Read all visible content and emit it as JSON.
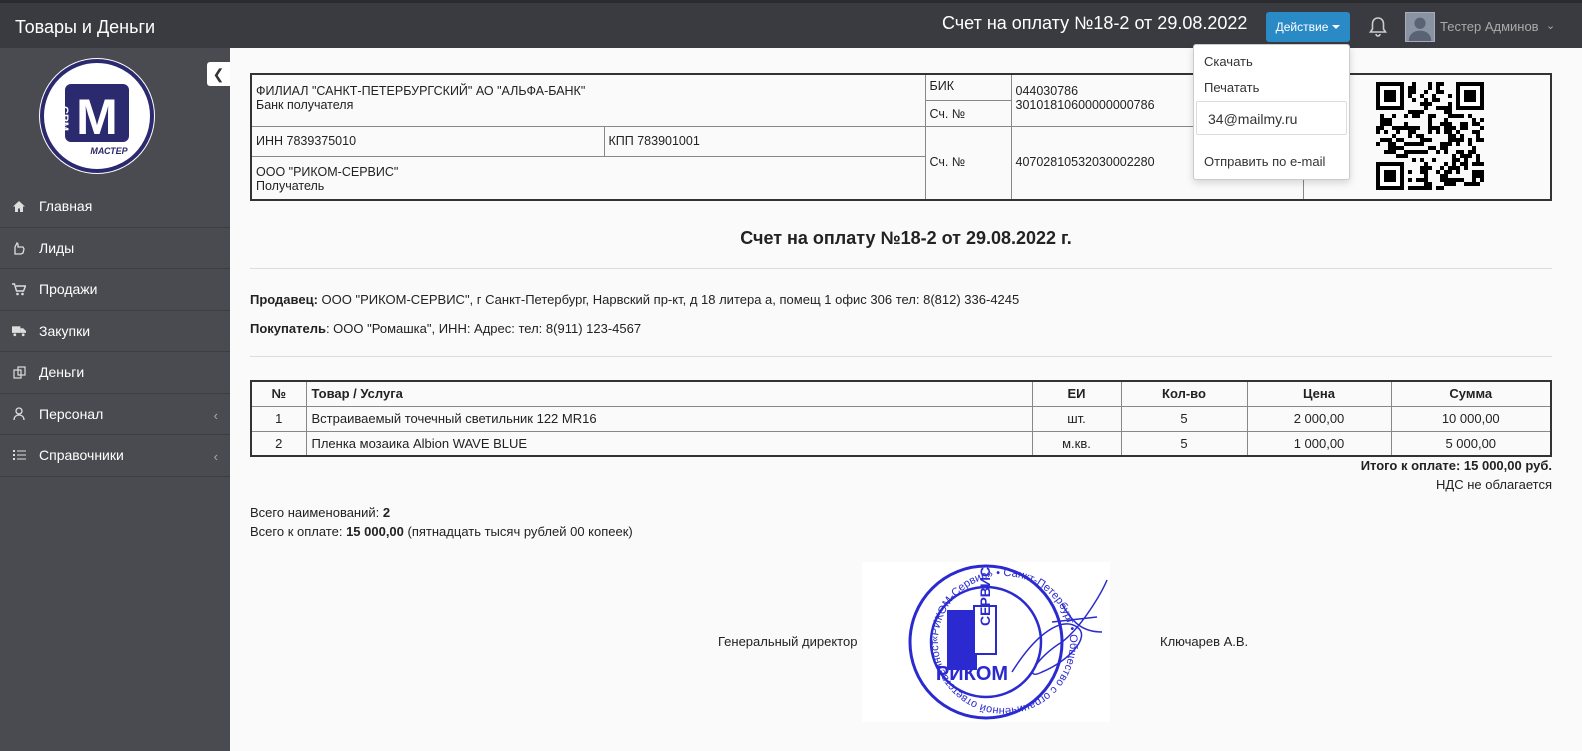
{
  "app": {
    "brand": "Товары и Деньги"
  },
  "header": {
    "doc_title": "Счет на оплату №18-2 от 29.08.2022",
    "action_label": "Действие",
    "user_name": "Тестер Админов"
  },
  "sidebar": {
    "items": [
      {
        "label": "Главная",
        "icon": "home-icon"
      },
      {
        "label": "Лиды",
        "icon": "hand-icon"
      },
      {
        "label": "Продажи",
        "icon": "cart-icon"
      },
      {
        "label": "Закупки",
        "icon": "truck-icon"
      },
      {
        "label": "Деньги",
        "icon": "money-icon"
      },
      {
        "label": "Персонал",
        "icon": "user-icon"
      },
      {
        "label": "Справочники",
        "icon": "list-icon"
      }
    ]
  },
  "logo": {
    "text_crm": "CRM",
    "text_master": "МАСТЕР",
    "letter": "M"
  },
  "dropdown": {
    "download": "Скачать",
    "print": "Печатать",
    "email_value": "34@mailmy.ru",
    "send": "Отправить по e-mail"
  },
  "bank": {
    "bank_name": "ФИЛИАЛ \"САНКТ-ПЕТЕРБУРГСКИЙ\" АО \"АЛЬФА-БАНК\"",
    "bank_caption": "Банк получателя",
    "bik_label": "БИК",
    "bik": "044030786",
    "acc_label": "Сч. №",
    "corr_acc": "30101810600000000786",
    "inn": "ИНН 7839375010",
    "kpp": "КПП 783901001",
    "recipient": "ООО \"РИКОМ-СЕРВИС\"",
    "recipient_caption": "Получатель",
    "acc_label2": "Сч. №",
    "account": "40702810532030002280"
  },
  "invoice": {
    "title": "Счет на оплату №18-2 от 29.08.2022 г.",
    "seller_label": "Продавец:",
    "seller": " ООО \"РИКОМ-СЕРВИС\", г Санкт-Петербург, Нарвский пр-кт, д 18 литера а, помещ 1 офис 306 тел: 8(812) 336-4245",
    "buyer_label": "Покупатель",
    "buyer": ": ООО \"Ромашка\", ИНН: Адрес:  тел: 8(911) 123-4567",
    "columns": [
      "№",
      "Товар / Услуга",
      "ЕИ",
      "Кол-во",
      "Цена",
      "Сумма"
    ],
    "rows": [
      {
        "n": "1",
        "name": "Встраиваемый точечный светильник 122 MR16",
        "unit": "шт.",
        "qty": "5",
        "price": "2 000,00",
        "sum": "10 000,00"
      },
      {
        "n": "2",
        "name": "Пленка мозаика Albion WAVE BLUE",
        "unit": "м.кв.",
        "qty": "5",
        "price": "1 000,00",
        "sum": "5 000,00"
      }
    ],
    "total": "Итого к оплате: 15 000,00 руб.",
    "nds": "НДС не облагается",
    "count_label": "Всего наименований: ",
    "count": "2",
    "pay_label": "Всего к оплате: ",
    "pay_amount": "15 000,00",
    "pay_words": " (пятнадцать тысяч рублей 00 копеек)",
    "director_label": "Генеральный директор",
    "director_name": "Ключарев А.В.",
    "stamp_text_top": "«РИКОМ-Сервис» • Санкт-Петербург • Общество с ограниченной ответственностью",
    "stamp_logo": "РИКОМ",
    "stamp_sub": "СЕРВИС"
  }
}
